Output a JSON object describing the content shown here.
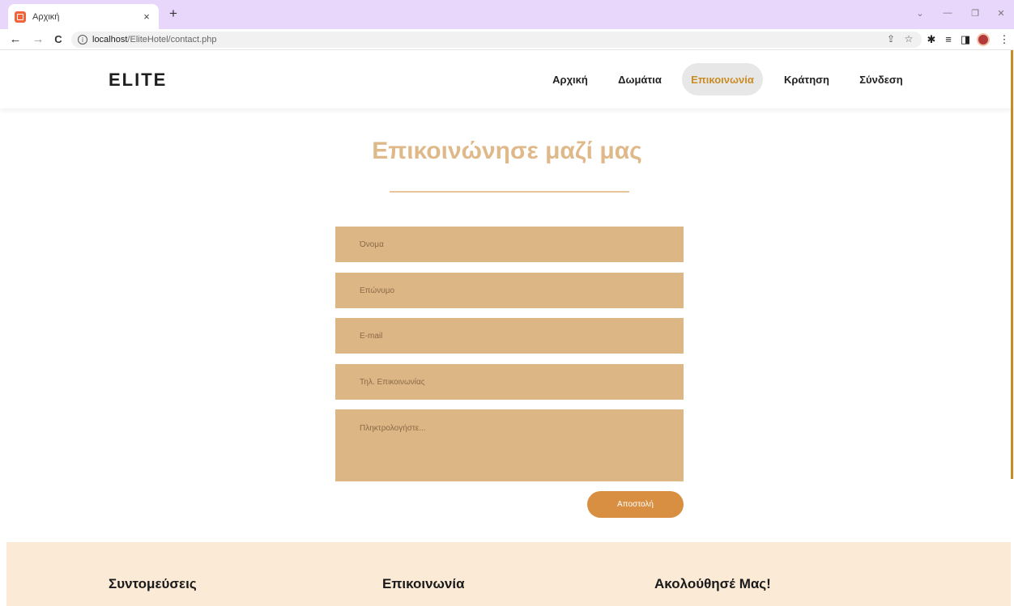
{
  "browser": {
    "tab_title": "Αρχική",
    "tab_close": "×",
    "new_tab": "+",
    "url_host": "localhost",
    "url_path": "/EliteHotel/contact.php",
    "win_controls": [
      "⌄",
      "—",
      "❐",
      "✕"
    ],
    "nav_glyphs": {
      "back": "←",
      "forward": "→",
      "reload": "C"
    },
    "omni_glyphs": {
      "share": "⇪",
      "star": "☆"
    },
    "ext_glyphs": {
      "puzzle": "✱",
      "queue": "≡",
      "sidebar": "◨",
      "menu": "⋮"
    }
  },
  "site": {
    "logo": "ELITE",
    "nav": [
      {
        "label": "Αρχική"
      },
      {
        "label": "Δωμάτια"
      },
      {
        "label": "Επικοινωνία",
        "active": true
      },
      {
        "label": "Κράτηση"
      },
      {
        "label": "Σύνδεση"
      }
    ]
  },
  "contact": {
    "title": "Επικοινώνησε μαζί μας",
    "fields": {
      "first_name": "Όνομα",
      "last_name": "Επώνυμο",
      "email": "E-mail",
      "phone": "Τηλ. Επικοινωνίας",
      "message": "Πληκτρολογήστε..."
    },
    "submit_label": "Αποστολή"
  },
  "footer": {
    "headings": [
      "Συντομεύσεις",
      "Επικοινωνία",
      "Ακολούθησέ Μας!"
    ]
  },
  "colors": {
    "accent": "#c98b24",
    "field_bg": "#ddb685",
    "button": "#d88f42",
    "footer_bg": "#faead6",
    "title": "#dfb98a"
  }
}
